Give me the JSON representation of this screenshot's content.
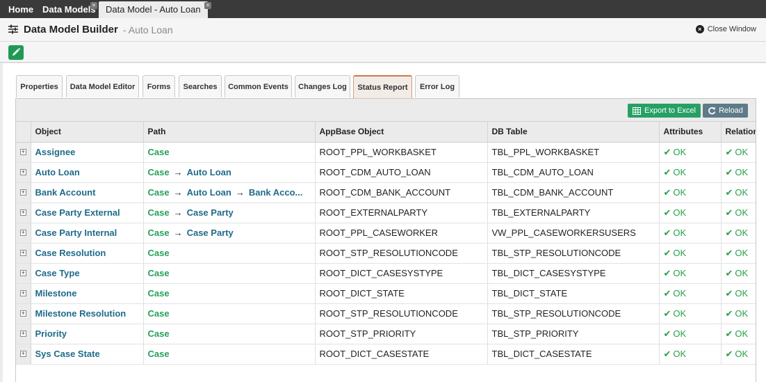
{
  "top_tabs": [
    {
      "label": "Home"
    },
    {
      "label": "Data Models"
    },
    {
      "label": "Data Model - Auto Loan"
    }
  ],
  "header": {
    "title": "Data Model Builder",
    "subtitle": "- Auto Loan",
    "close_label": "Close Window"
  },
  "tabs": [
    {
      "label": "Properties"
    },
    {
      "label": "Data Model Editor"
    },
    {
      "label": "Forms"
    },
    {
      "label": "Searches"
    },
    {
      "label": "Common Events"
    },
    {
      "label": "Changes Log"
    },
    {
      "label": "Status Report"
    },
    {
      "label": "Error Log"
    }
  ],
  "active_tab": "Status Report",
  "buttons": {
    "export": "Export to Excel",
    "reload": "Reload"
  },
  "table": {
    "columns": [
      "Object",
      "Path",
      "AppBase Object",
      "DB Table",
      "Attributes",
      "Relation"
    ],
    "rows": [
      {
        "object": "Assignee",
        "path": [
          "Case"
        ],
        "appbase": "ROOT_PPL_WORKBASKET",
        "db": "TBL_PPL_WORKBASKET",
        "attributes": "OK",
        "relation": "OK"
      },
      {
        "object": "Auto Loan",
        "path": [
          "Case",
          "Auto Loan"
        ],
        "appbase": "ROOT_CDM_AUTO_LOAN",
        "db": "TBL_CDM_AUTO_LOAN",
        "attributes": "OK",
        "relation": "OK"
      },
      {
        "object": "Bank Account",
        "path": [
          "Case",
          "Auto Loan",
          "Bank Acco..."
        ],
        "appbase": "ROOT_CDM_BANK_ACCOUNT",
        "db": "TBL_CDM_BANK_ACCOUNT",
        "attributes": "OK",
        "relation": "OK"
      },
      {
        "object": "Case Party External",
        "path": [
          "Case",
          "Case Party"
        ],
        "appbase": "ROOT_EXTERNALPARTY",
        "db": "TBL_EXTERNALPARTY",
        "attributes": "OK",
        "relation": "OK"
      },
      {
        "object": "Case Party Internal",
        "path": [
          "Case",
          "Case Party"
        ],
        "appbase": "ROOT_PPL_CASEWORKER",
        "db": "VW_PPL_CASEWORKERSUSERS",
        "attributes": "OK",
        "relation": "OK"
      },
      {
        "object": "Case Resolution",
        "path": [
          "Case"
        ],
        "appbase": "ROOT_STP_RESOLUTIONCODE",
        "db": "TBL_STP_RESOLUTIONCODE",
        "attributes": "OK",
        "relation": "OK"
      },
      {
        "object": "Case Type",
        "path": [
          "Case"
        ],
        "appbase": "ROOT_DICT_CASESYSTYPE",
        "db": "TBL_DICT_CASESYSTYPE",
        "attributes": "OK",
        "relation": "OK"
      },
      {
        "object": "Milestone",
        "path": [
          "Case"
        ],
        "appbase": "ROOT_DICT_STATE",
        "db": "TBL_DICT_STATE",
        "attributes": "OK",
        "relation": "OK"
      },
      {
        "object": "Milestone Resolution",
        "path": [
          "Case"
        ],
        "appbase": "ROOT_STP_RESOLUTIONCODE",
        "db": "TBL_STP_RESOLUTIONCODE",
        "attributes": "OK",
        "relation": "OK"
      },
      {
        "object": "Priority",
        "path": [
          "Case"
        ],
        "appbase": "ROOT_STP_PRIORITY",
        "db": "TBL_STP_PRIORITY",
        "attributes": "OK",
        "relation": "OK"
      },
      {
        "object": "Sys Case State",
        "path": [
          "Case"
        ],
        "appbase": "ROOT_DICT_CASESTATE",
        "db": "TBL_DICT_CASESTATE",
        "attributes": "OK",
        "relation": "OK"
      }
    ]
  },
  "colors": {
    "topbar": "#3a3a3a",
    "object_link": "#1f6b8a",
    "path_case": "#26a05a",
    "ok": "#27a048",
    "export_button": "#27a066",
    "reload_button": "#5e7b89",
    "active_tab_border": "#c9794f"
  },
  "icons": {
    "header": "sliders-icon",
    "edit": "pencil-icon",
    "close": "close-circle-icon",
    "export": "table-grid-icon",
    "reload": "refresh-icon",
    "ok": "checkmark-icon",
    "expand": "plus-square-icon"
  }
}
